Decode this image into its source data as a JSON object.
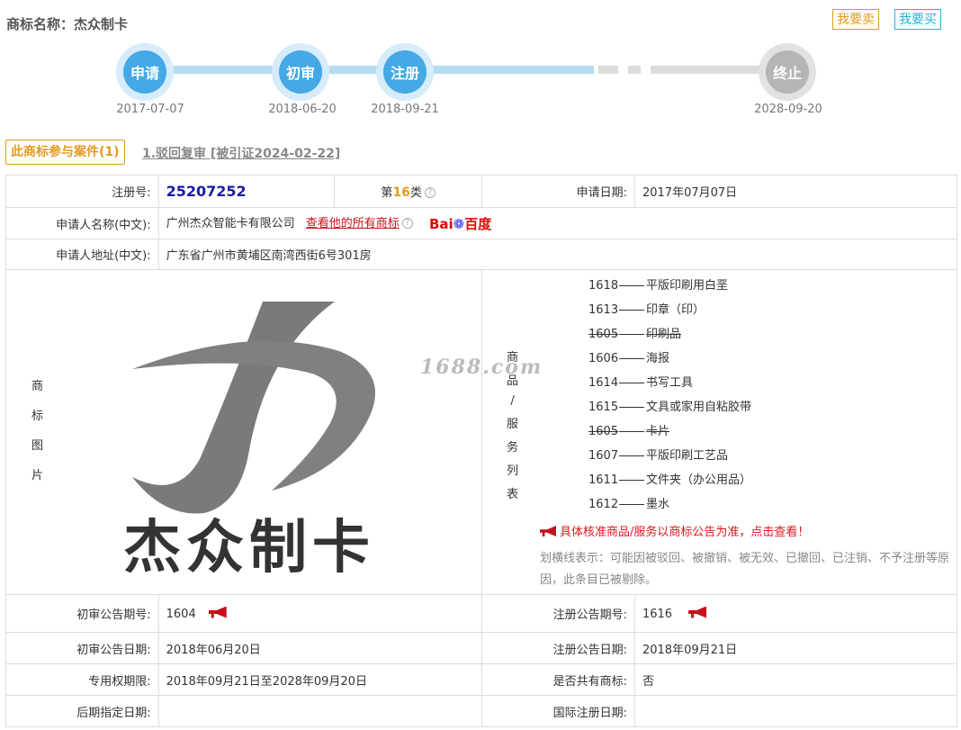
{
  "header": {
    "title": "商标名称：杰众制卡",
    "sell_label": "我要卖",
    "buy_label": "我要买"
  },
  "timeline": {
    "steps": [
      {
        "label": "申请",
        "date": "2017-07-07",
        "status": "done"
      },
      {
        "label": "初审",
        "date": "2018-06-20",
        "status": "done"
      },
      {
        "label": "注册",
        "date": "2018-09-21",
        "status": "done"
      },
      {
        "label": "终止",
        "date": "2028-09-20",
        "status": "pending"
      }
    ]
  },
  "cases": {
    "tab_label": "此商标参与案件(1)",
    "link_label": "1.驳回复审 [被引证2024-02-22]"
  },
  "info": {
    "reg_no_label": "注册号:",
    "reg_no": "25207252",
    "class_prefix": "第",
    "class_num": "16",
    "class_suffix": "类",
    "apply_date_label": "申请日期:",
    "apply_date": "2017年07月07日",
    "applicant_label": "申请人名称(中文):",
    "applicant": "广州杰众智能卡有限公司",
    "all_marks_link": "查看他的所有商标",
    "baidu_b1": "Bai",
    "baidu_b2": "百度",
    "address_label": "申请人地址(中文):",
    "address": "广东省广州市黄埔区南湾西街6号301房",
    "image_label_chars": [
      "商",
      "标",
      "图",
      "片"
    ],
    "logo_text": "杰众制卡",
    "watermark": "1688.com",
    "goods_label_chars": [
      "商",
      "品",
      "/",
      "服",
      "务",
      "列",
      "表"
    ],
    "goods": [
      {
        "code": "1618",
        "name": "平版印刷用白垩",
        "struck": false
      },
      {
        "code": "1613",
        "name": "印章（印）",
        "struck": false
      },
      {
        "code": "1605",
        "name": "印刷品",
        "struck": true
      },
      {
        "code": "1606",
        "name": "海报",
        "struck": false
      },
      {
        "code": "1614",
        "name": "书写工具",
        "struck": false
      },
      {
        "code": "1615",
        "name": "文具或家用自粘胶带",
        "struck": false
      },
      {
        "code": "1605",
        "name": "卡片",
        "struck": true
      },
      {
        "code": "1607",
        "name": "平版印刷工艺品",
        "struck": false
      },
      {
        "code": "1611",
        "name": "文件夹（办公用品）",
        "struck": false
      },
      {
        "code": "1612",
        "name": "墨水",
        "struck": false
      }
    ],
    "goods_notice": "具体核准商品/服务以商标公告为准，点击查看！",
    "goods_note": "划横线表示：可能因被驳回、被撤销、被无效、已撤回、已注销、不予注册等原因，此条目已被剔除。",
    "prelim_no_label": "初审公告期号:",
    "prelim_no": "1604",
    "reg_pub_no_label": "注册公告期号:",
    "reg_pub_no": "1616",
    "prelim_date_label": "初审公告日期:",
    "prelim_date": "2018年06月20日",
    "reg_pub_date_label": "注册公告日期:",
    "reg_pub_date": "2018年09月21日",
    "exclusive_label": "专用权期限:",
    "exclusive": "2018年09月21日至2028年09月20日",
    "shared_label": "是否共有商标:",
    "shared": "否",
    "later_label": "后期指定日期:",
    "later": "",
    "intl_label": "国际注册日期:",
    "intl": ""
  },
  "colors": {
    "accent_orange": "#e49b1f",
    "accent_blue": "#44a9e5",
    "link_red": "#c4121b",
    "regno_blue": "#1a1aa8"
  }
}
